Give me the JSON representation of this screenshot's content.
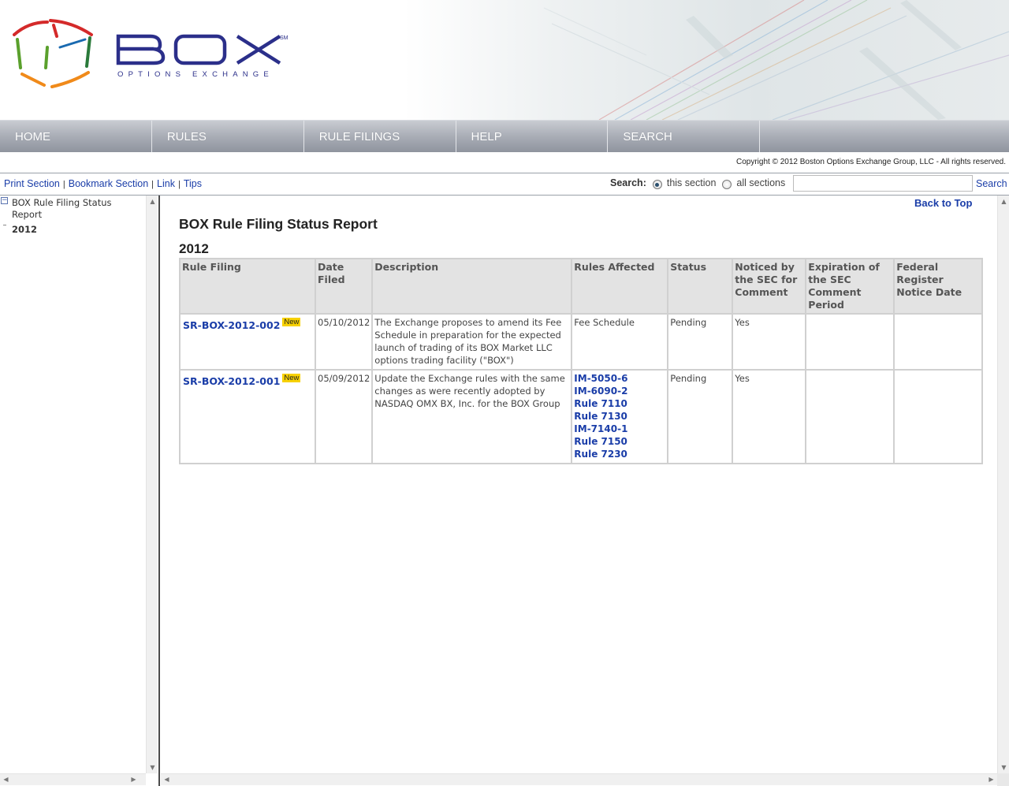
{
  "brand": {
    "name": "BOX",
    "trademark": "SM",
    "tagline": "OPTIONS EXCHANGE",
    "colors": {
      "navy": "#2b2f8a",
      "link": "#1a3da8",
      "badge": "#f7d100"
    }
  },
  "nav": {
    "items": [
      {
        "label": "HOME"
      },
      {
        "label": "RULES"
      },
      {
        "label": "RULE FILINGS"
      },
      {
        "label": "HELP"
      },
      {
        "label": "SEARCH"
      }
    ]
  },
  "copyright": "Copyright © 2012 Boston Options Exchange Group, LLC - All rights reserved.",
  "toolbar": {
    "print": "Print Section",
    "bookmark": "Bookmark Section",
    "link": "Link",
    "tips": "Tips",
    "separator": "|",
    "search_label": "Search:",
    "scope_this": "this section",
    "scope_all": "all sections",
    "search_button": "Search",
    "search_value": ""
  },
  "tree": {
    "root_label": "BOX Rule Filing Status Report",
    "root_toggle": "−",
    "child_label": "2012"
  },
  "content": {
    "back_to_top": "Back to Top",
    "title": "BOX Rule Filing Status Report",
    "year": "2012",
    "columns": [
      "Rule Filing",
      "Date Filed",
      "Description",
      "Rules Affected",
      "Status",
      "Noticed by the SEC for Comment",
      "Expiration of the SEC Comment Period",
      "Federal Register Notice Date"
    ],
    "rows": [
      {
        "filing": "SR-BOX-2012-002",
        "badge": "New",
        "date": "05/10/2012",
        "description": "The Exchange proposes to amend its Fee Schedule in preparation for the expected launch of trading of its BOX Market LLC options trading facility (\"BOX\")",
        "rules_text": "Fee Schedule",
        "rules": [],
        "status": "Pending",
        "noticed": "Yes",
        "expiration": "",
        "federal": ""
      },
      {
        "filing": "SR-BOX-2012-001",
        "badge": "New",
        "date": "05/09/2012",
        "description": "Update the Exchange rules with the same changes as were recently adopted by NASDAQ OMX BX, Inc. for the BOX Group",
        "rules_text": "",
        "rules": [
          "IM-5050-6",
          "IM-6090-2",
          "Rule 7110",
          "Rule 7130",
          "IM-7140-1",
          "Rule 7150",
          "Rule 7230"
        ],
        "status": "Pending",
        "noticed": "Yes",
        "expiration": "",
        "federal": ""
      }
    ]
  }
}
